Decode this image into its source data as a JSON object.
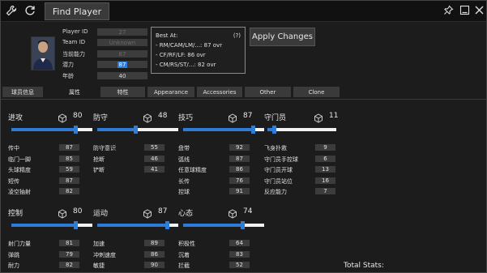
{
  "toolbar": {
    "icons": [
      "wrench-icon",
      "refresh-icon"
    ],
    "find_player_label": "Find Player",
    "window_icons": [
      "pin-icon",
      "minimize-icon",
      "close-icon"
    ]
  },
  "player_info": {
    "player_id_label": "Player ID",
    "player_id_value": "27",
    "team_id_label": "Team ID",
    "team_id_value": "Unknown",
    "current_ability_label": "当前能力",
    "current_ability_value": "87",
    "potential_label": "潜力",
    "potential_value": "87",
    "age_label": "年龄",
    "age_value": "40"
  },
  "best_at": {
    "title": "Best At:",
    "help": "(?)",
    "lines": [
      "- RM/CAM/LM/...: 87 ovr",
      "- CF/RF/LF: 86 ovr",
      "- CM/RS/ST/...: 82 ovr"
    ]
  },
  "apply_label": "Apply Changes",
  "tabs": [
    "球员信息",
    "属性",
    "特性",
    "Appearance",
    "Accessories",
    "Other",
    "Clone"
  ],
  "active_tab": 1,
  "groups": [
    {
      "title": "进攻",
      "total": "80",
      "fill": 0.8,
      "stats": [
        {
          "label": "传中",
          "value": "87"
        },
        {
          "label": "临门一脚",
          "value": "85"
        },
        {
          "label": "头球精度",
          "value": "59"
        },
        {
          "label": "短传",
          "value": "87"
        },
        {
          "label": "凌空抽射",
          "value": "82"
        }
      ]
    },
    {
      "title": "防守",
      "total": "48",
      "fill": 0.48,
      "stats": [
        {
          "label": "防守意识",
          "value": "55"
        },
        {
          "label": "抢断",
          "value": "46"
        },
        {
          "label": "铲断",
          "value": "41"
        }
      ]
    },
    {
      "title": "技巧",
      "total": "87",
      "fill": 0.87,
      "stats": [
        {
          "label": "盘带",
          "value": "92"
        },
        {
          "label": "弧线",
          "value": "87"
        },
        {
          "label": "任意球精度",
          "value": "86"
        },
        {
          "label": "长传",
          "value": "76"
        },
        {
          "label": "控球",
          "value": "91"
        }
      ]
    },
    {
      "title": "守门员",
      "total": "11",
      "fill": 0.11,
      "stats": [
        {
          "label": "飞身扑救",
          "value": "9"
        },
        {
          "label": "守门员手控球",
          "value": "6"
        },
        {
          "label": "守门员开球",
          "value": "13"
        },
        {
          "label": "守门员站位",
          "value": "16"
        },
        {
          "label": "反应能力",
          "value": "7"
        }
      ]
    },
    {
      "title": "控制",
      "total": "80",
      "fill": 0.8,
      "stats": [
        {
          "label": "射门力量",
          "value": "81"
        },
        {
          "label": "弹跳",
          "value": "79"
        },
        {
          "label": "耐力",
          "value": "82"
        }
      ]
    },
    {
      "title": "运动",
      "total": "87",
      "fill": 0.87,
      "stats": [
        {
          "label": "加速",
          "value": "89"
        },
        {
          "label": "冲刺速度",
          "value": "86"
        },
        {
          "label": "敏捷",
          "value": "90"
        }
      ]
    },
    {
      "title": "心态",
      "total": "74",
      "fill": 0.74,
      "stats": [
        {
          "label": "积极性",
          "value": "64"
        },
        {
          "label": "沉着",
          "value": "83"
        },
        {
          "label": "拦截",
          "value": "52"
        }
      ]
    }
  ],
  "total_stats_label": "Total Stats:",
  "colors": {
    "accent": "#2f7cd6",
    "background": "#1c1c1c",
    "field": "#3c3c3c"
  }
}
